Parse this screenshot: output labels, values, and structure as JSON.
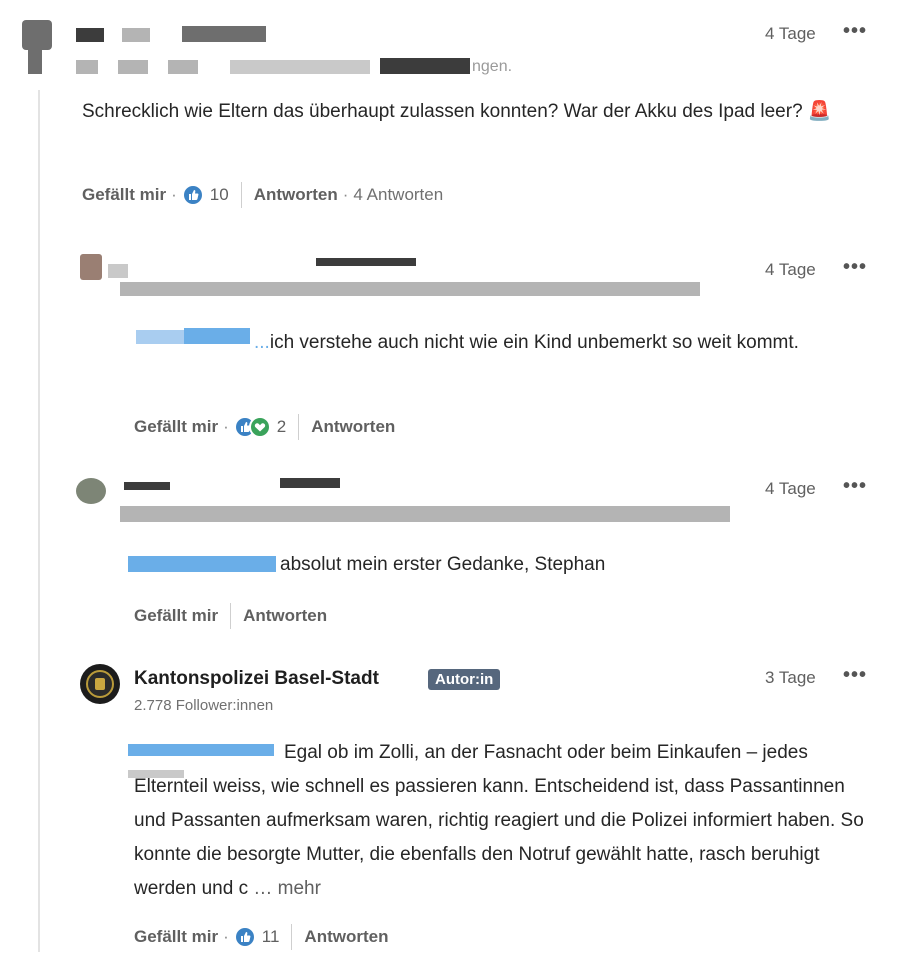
{
  "comments": [
    {
      "time": "4 Tage",
      "text": "Schrecklich wie Eltern das überhaupt zulassen konnten? War der Akku des Ipad leer? 🚨",
      "like_label": "Gefällt mir",
      "reaction_count": "10",
      "reply_label": "Antworten",
      "reply_count": "4 Antworten",
      "name_fragment": "ngen."
    },
    {
      "time": "4 Tage",
      "text_prefix": "...",
      "text": "ich verstehe auch nicht wie ein Kind unbemerkt so weit kommt.",
      "like_label": "Gefällt mir",
      "reaction_count": "2",
      "reply_label": "Antworten"
    },
    {
      "time": "4 Tage",
      "text": "absolut mein erster Gedanke, Stephan",
      "like_label": "Gefällt mir",
      "reply_label": "Antworten"
    },
    {
      "author": "Kantonspolizei Basel-Stadt",
      "badge": "Autor:in",
      "followers": "2.778 Follower:innen",
      "time": "3 Tage",
      "text": "Egal ob im Zolli, an der Fasnacht oder beim Einkaufen – jedes Elternteil weiss, wie schnell es passieren kann. Entscheidend ist, dass Passantinnen und Passanten aufmerksam waren, richtig reagiert und die Polizei informiert haben. So konnte die besorgte Mutter, die ebenfalls den Notruf gewählt hatte, rasch beruhigt werden und c",
      "more_label": "… mehr",
      "like_label": "Gefällt mir",
      "reaction_count": "11",
      "reply_label": "Antworten"
    }
  ],
  "icons": {
    "more": "more-options-icon",
    "like_reaction": "like-reaction-icon",
    "love_reaction": "support-reaction-icon",
    "siren": "siren-emoji"
  },
  "colors": {
    "badge": "#56677d",
    "like_reaction": "#3b82c4",
    "support_reaction": "#3aa35b"
  }
}
